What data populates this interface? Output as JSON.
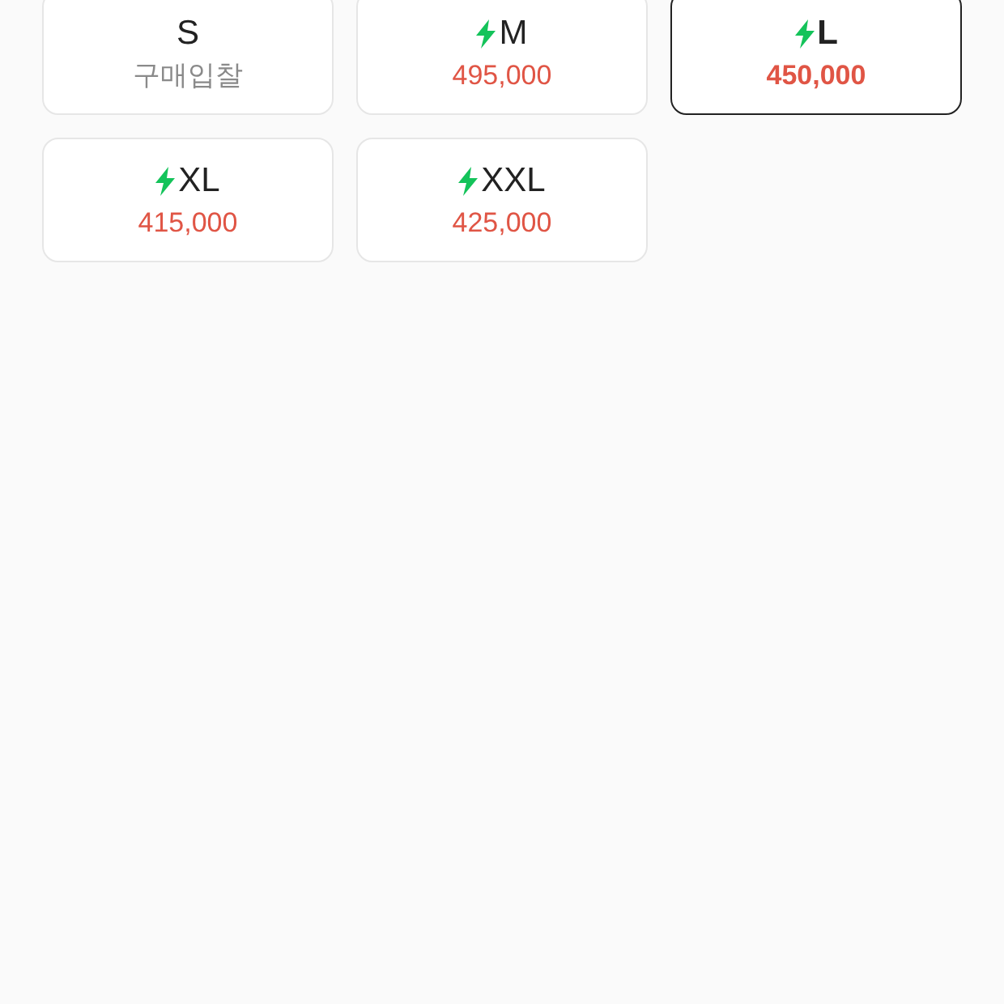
{
  "sizes": [
    {
      "size": "S",
      "express": false,
      "kind": "bid",
      "price": "구매입찰",
      "selected": false
    },
    {
      "size": "M",
      "express": true,
      "kind": "price",
      "price": "495,000",
      "selected": false
    },
    {
      "size": "L",
      "express": true,
      "kind": "price",
      "price": "450,000",
      "selected": true
    },
    {
      "size": "XL",
      "express": true,
      "kind": "price",
      "price": "415,000",
      "selected": false
    },
    {
      "size": "XXL",
      "express": true,
      "kind": "price",
      "price": "425,000",
      "selected": false
    }
  ]
}
